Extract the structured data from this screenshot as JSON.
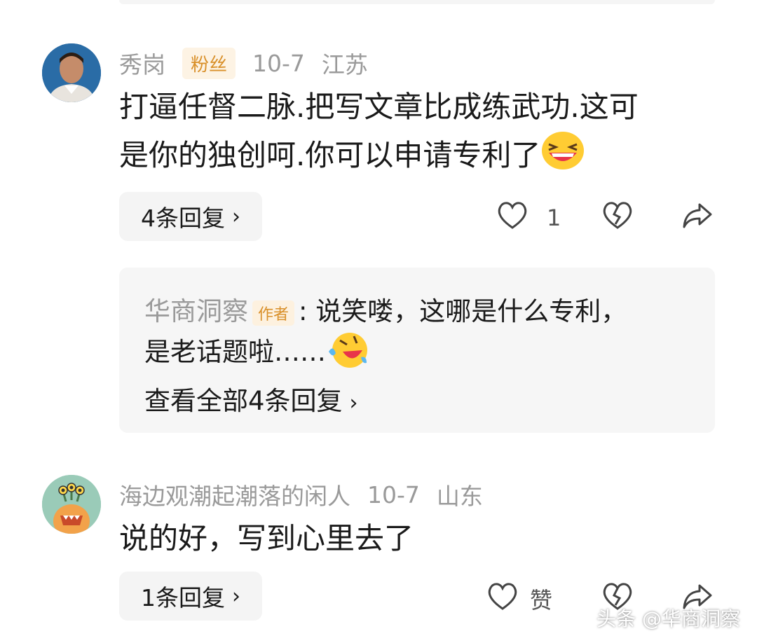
{
  "comments": [
    {
      "username": "秀岗",
      "badge": "粉丝",
      "date": "10-7",
      "location": "江苏",
      "text_line1": "打逼任督二脉.把写文章比成练武功.这可",
      "text_line2": "是你的独创呵.你可以申请专利了",
      "reply_chip": "4条回复",
      "like_count": "1",
      "avatar_icon": "person-portrait",
      "emoji_icon": "grinning-squinting-face-icon"
    },
    {
      "username": "海边观潮起潮落的闲人",
      "date": "10-7",
      "location": "山东",
      "text_line1": "说的好，写到心里去了",
      "reply_chip": "1条回复",
      "like_label": "赞",
      "avatar_icon": "green-monster-avatar"
    }
  ],
  "author_reply": {
    "name": "华商洞察",
    "badge": "作者",
    "line1": ": 说笑喽，这哪是什么专利，",
    "line2": "是老话题啦……",
    "view_all": "查看全部4条回复",
    "emoji_icon": "rolling-on-floor-laughing-icon"
  },
  "watermark": "头条 @华商洞察",
  "colors": {
    "badge_fg": "#d9902a",
    "badge_bg": "#fdf3e4",
    "meta_text": "#9a9a9a",
    "panel_bg": "#f4f4f4"
  }
}
